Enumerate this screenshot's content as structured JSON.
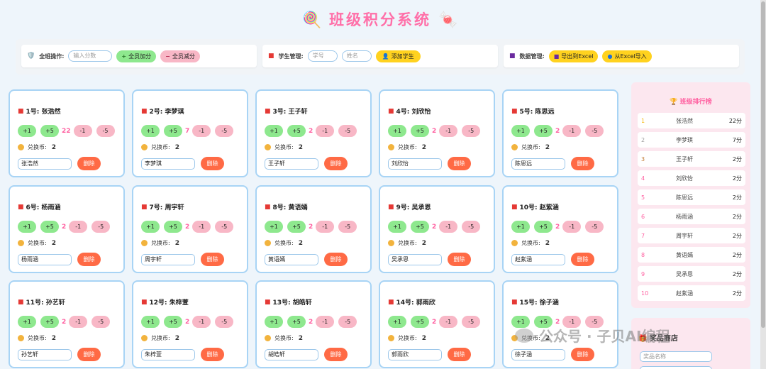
{
  "header": {
    "title": "班级积分系统",
    "icon_left": "lollipop-icon",
    "icon_right": "candy-icon"
  },
  "toolbar": {
    "class_ops": {
      "label": "全班操作:",
      "placeholder": "输入分数",
      "add_all": "全员加分",
      "sub_all": "全员减分"
    },
    "student_mgmt": {
      "label": "学生管理:",
      "id_placeholder": "学号",
      "name_placeholder": "姓名",
      "add_student": "添加学生"
    },
    "data_mgmt": {
      "label": "数据管理:",
      "export": "导出到Excel",
      "import": "从Excel导入"
    }
  },
  "card_labels": {
    "plus1": "+1",
    "plus5": "+5",
    "minus1": "-1",
    "minus5": "-5",
    "coins_label": "兑换币:",
    "delete": "删除"
  },
  "students": [
    {
      "title": "1号: 张浩然",
      "name": "张浩然",
      "score": "22",
      "coins": "2"
    },
    {
      "title": "2号: 李梦琪",
      "name": "李梦琪",
      "score": "7",
      "coins": "2"
    },
    {
      "title": "3号: 王子轩",
      "name": "王子轩",
      "score": "2",
      "coins": "2"
    },
    {
      "title": "4号: 刘欣怡",
      "name": "刘欣怡",
      "score": "2",
      "coins": "2"
    },
    {
      "title": "5号: 陈思远",
      "name": "陈思远",
      "score": "2",
      "coins": "2"
    },
    {
      "title": "6号: 杨雨涵",
      "name": "杨雨涵",
      "score": "2",
      "coins": "2"
    },
    {
      "title": "7号: 周宇轩",
      "name": "周宇轩",
      "score": "2",
      "coins": "2"
    },
    {
      "title": "8号: 黄语嫣",
      "name": "黄语嫣",
      "score": "2",
      "coins": "2"
    },
    {
      "title": "9号: 吴承恩",
      "name": "吴承恩",
      "score": "2",
      "coins": "2"
    },
    {
      "title": "10号: 赵紫涵",
      "name": "赵紫涵",
      "score": "2",
      "coins": "2"
    },
    {
      "title": "11号: 孙艺轩",
      "name": "孙艺轩",
      "score": "2",
      "coins": "2"
    },
    {
      "title": "12号: 朱梓萱",
      "name": "朱梓萱",
      "score": "2",
      "coins": "2"
    },
    {
      "title": "13号: 胡皓轩",
      "name": "胡皓轩",
      "score": "2",
      "coins": "2"
    },
    {
      "title": "14号: 郭雨欣",
      "name": "郭雨欣",
      "score": "2",
      "coins": "2"
    },
    {
      "title": "15号: 徐子涵",
      "name": "徐子涵",
      "score": "2",
      "coins": "2"
    }
  ],
  "ranking": {
    "title": "班级排行榜",
    "rows": [
      {
        "rank": "1",
        "name": "张浩然",
        "score": "22分"
      },
      {
        "rank": "2",
        "name": "李梦琪",
        "score": "7分"
      },
      {
        "rank": "3",
        "name": "王子轩",
        "score": "2分"
      },
      {
        "rank": "4",
        "name": "刘欣怡",
        "score": "2分"
      },
      {
        "rank": "5",
        "name": "陈思远",
        "score": "2分"
      },
      {
        "rank": "6",
        "name": "杨雨涵",
        "score": "2分"
      },
      {
        "rank": "7",
        "name": "周宇轩",
        "score": "2分"
      },
      {
        "rank": "8",
        "name": "黄语嫣",
        "score": "2分"
      },
      {
        "rank": "9",
        "name": "吴承恩",
        "score": "2分"
      },
      {
        "rank": "10",
        "name": "赵紫涵",
        "score": "2分"
      }
    ]
  },
  "shop": {
    "title": "奖品商店",
    "placeholder": "奖品名称"
  },
  "watermark": {
    "text": "公众号 · 子贝AI编程"
  },
  "colors": {
    "accent_pink": "#ff6fa8",
    "add_green": "#8ee88e",
    "sub_pink": "#f8b7c6",
    "action_yellow": "#ffd21f",
    "delete_orange": "#ff6a45",
    "card_border": "#a8d4f5",
    "rank_colors": [
      "#f5b400",
      "#9e9e9e",
      "#c0792e",
      "#ff5fa0"
    ]
  }
}
